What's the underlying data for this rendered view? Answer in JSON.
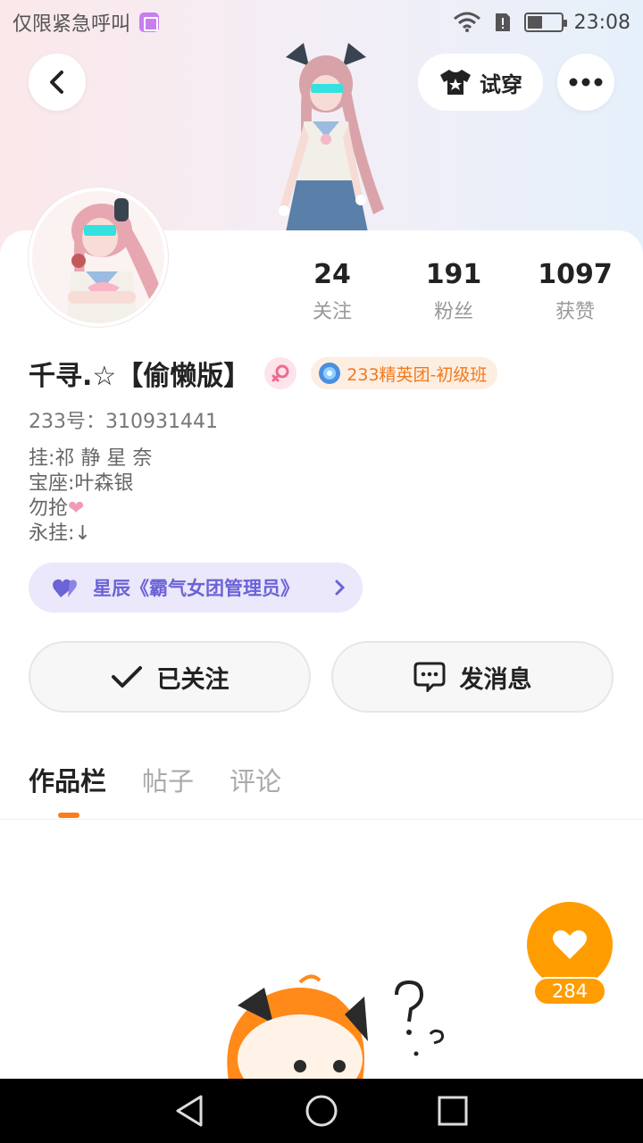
{
  "status_bar": {
    "carrier_text": "仅限紧急呼叫",
    "time": "23:08"
  },
  "header": {
    "try_on_label": "试穿"
  },
  "profile": {
    "stats": [
      {
        "value": "24",
        "label": "关注"
      },
      {
        "value": "191",
        "label": "粉丝"
      },
      {
        "value": "1097",
        "label": "获赞"
      }
    ],
    "name": "千寻.☆【偷懒版】",
    "rank_badge": "233精英团-初级班",
    "id_label": "233号：310931441",
    "bio_lines": [
      "挂:祁 静 星 奈",
      "宝座:叶森银",
      "勿抢",
      "永挂:↓"
    ],
    "fan_group": "星辰《霸气女团管理员》"
  },
  "actions": {
    "follow_label": "已关注",
    "message_label": "发消息"
  },
  "tabs": [
    "作品栏",
    "帖子",
    "评论"
  ],
  "like": {
    "count": "284"
  },
  "colors": {
    "accent_orange": "#ff9d00",
    "tab_indicator": "#ff7a1a",
    "fan_group_bg": "#ebe8fb",
    "fan_group_text": "#6b63d6",
    "rank_text": "#f07a1f"
  }
}
